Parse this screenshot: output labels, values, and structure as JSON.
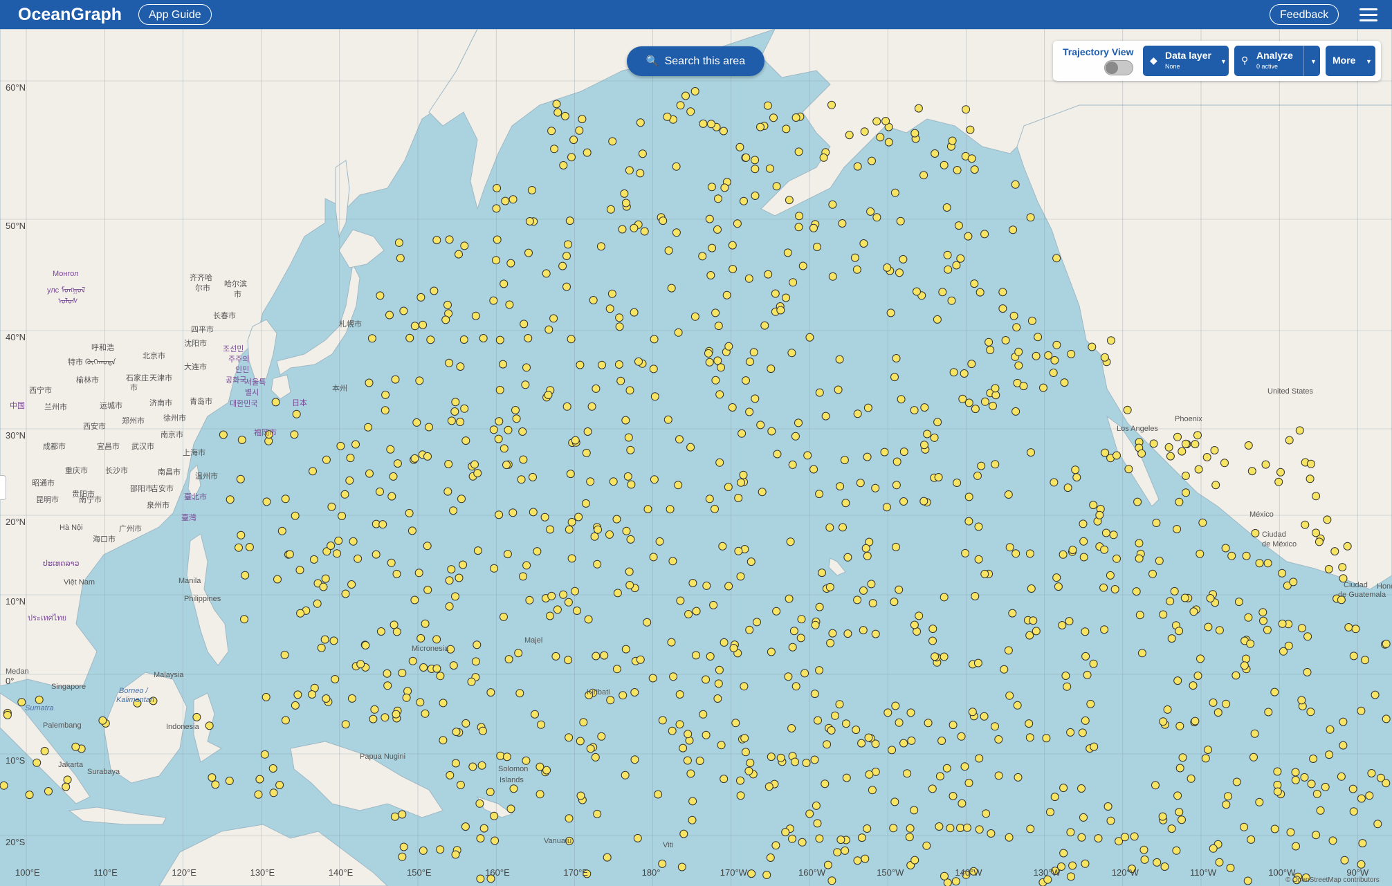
{
  "header": {
    "brand": "OceanGraph",
    "app_guide_label": "App Guide",
    "feedback_label": "Feedback",
    "menu_icon": "hamburger-menu-icon"
  },
  "search": {
    "label": "Search this area",
    "icon": "search-icon"
  },
  "controls": {
    "trajectory_label": "Trajectory View",
    "trajectory_on": false,
    "data_layer": {
      "title": "Data layer",
      "value": "None",
      "icon": "layers-icon"
    },
    "analyze": {
      "title": "Analyze",
      "value": "0 active",
      "icon": "analyze-icon"
    },
    "more": {
      "title": "More"
    }
  },
  "colors": {
    "header": "#1f5dab",
    "ocean": "#aad3df",
    "land": "#f2efe9",
    "marker": "#f6e462",
    "marker_stroke": "#333333"
  },
  "map": {
    "lat_labels": [
      "60°N",
      "50°N",
      "40°N",
      "30°N",
      "20°N",
      "10°N",
      "0°",
      "10°S",
      "20°S"
    ],
    "lon_labels": [
      "100°E",
      "110°E",
      "120°E",
      "130°E",
      "140°E",
      "150°E",
      "160°E",
      "170°E",
      "180°",
      "170°W",
      "160°W",
      "150°W",
      "140°W",
      "130°W",
      "120°W",
      "110°W",
      "100°W",
      "90°W"
    ],
    "places": [
      "Монгол",
      "улс ᠮᠣᠩᠭᠣᠯ",
      "ᠤᠯᠤᠰ",
      "齐齐哈",
      "尔市",
      "哈尔滨",
      "市",
      "长春市",
      "四平市",
      "沈阳市",
      "呼和浩",
      "特市 ᠬᠥᠬᠡᠬᠣᠲᠠ",
      "北京市",
      "大连市",
      "조선민",
      "주주의",
      "인민",
      "공화국",
      "榆林市",
      "石家庄",
      "市",
      "天津市",
      "西宁市",
      "兰州市",
      "运城市",
      "济南市",
      "서울특",
      "별시",
      "대한민국",
      "中国",
      "西安市",
      "郑州市",
      "徐州市",
      "青岛市",
      "日本",
      "本州",
      "札幌市",
      "福岡市",
      "南京市",
      "上海市",
      "成都市",
      "宜昌市",
      "武汉市",
      "重庆市",
      "长沙市",
      "南昌市",
      "温州市",
      "昭通市",
      "贵阳市",
      "邵阳市",
      "吉安市",
      "昆明市",
      "南宁市",
      "泉州市",
      "臺北市",
      "臺灣",
      "广州市",
      "Hà Nội",
      "海口市",
      "ປະເທດລາວ",
      "Việt Nam",
      "Manila",
      "Philippines",
      "ประเทศไทย",
      "Malaysia",
      "Medan",
      "Singapore",
      "Sumatra",
      "Borneo /",
      "Kalimantan",
      "Palembang",
      "Indonesia",
      "Surabaya",
      "Jakarta",
      "Papua Nugini",
      "Micronesia",
      "Majel",
      "Kiribati",
      "Solomon",
      "Islands",
      "Vanuatu",
      "Viti",
      "Los Angeles",
      "Phoenix",
      "United States",
      "México",
      "Ciudad",
      "de México",
      "Ciudad",
      "de Guatemala",
      "Hond"
    ],
    "attribution": "© OpenStreetMap contributors"
  }
}
